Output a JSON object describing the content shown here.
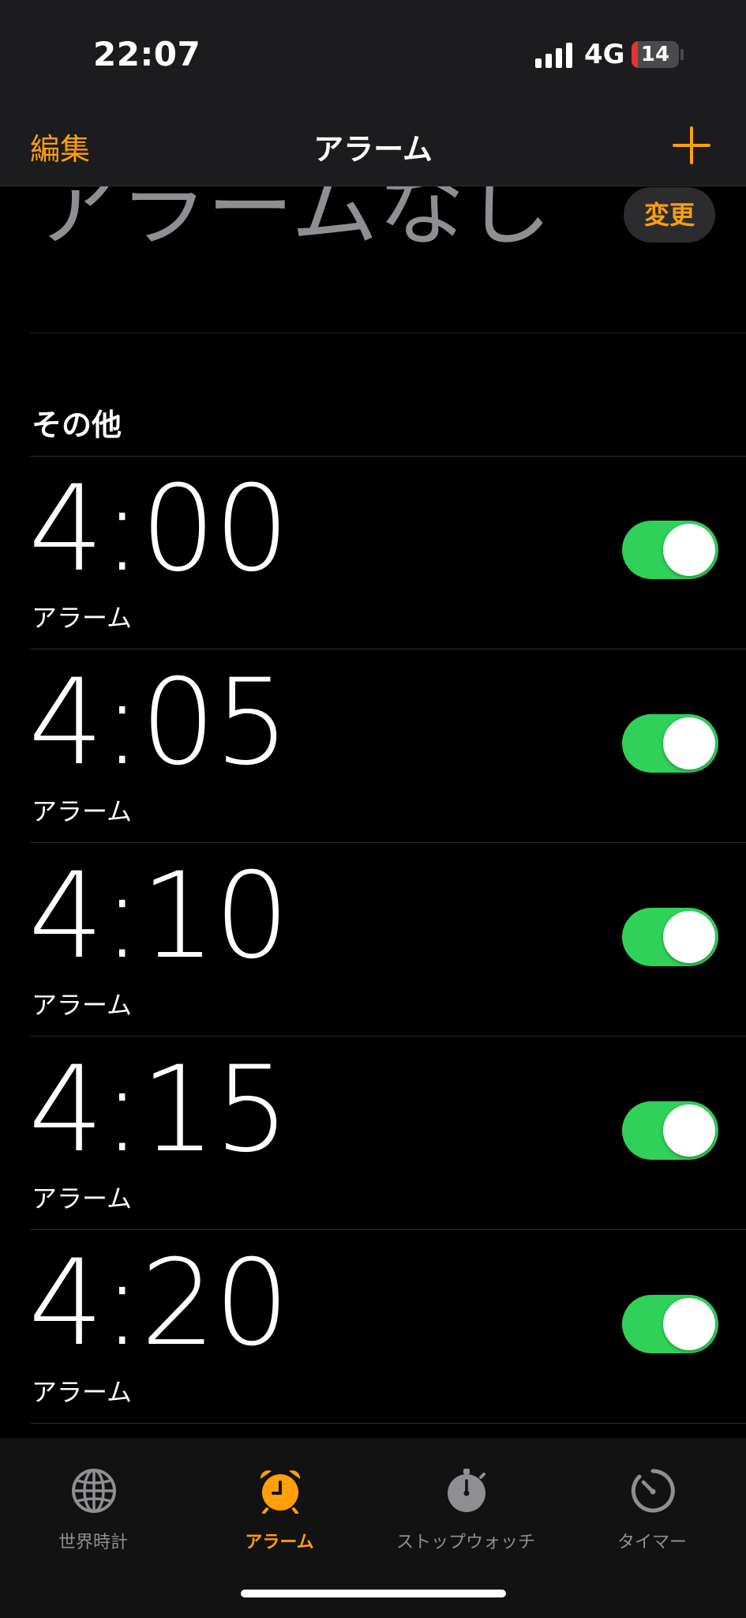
{
  "status_bar": {
    "time": "22:07",
    "network": "4G",
    "battery": "14",
    "battery_fraction": 0.14
  },
  "nav": {
    "edit_label": "編集",
    "title": "アラーム",
    "add_icon": "plus-icon"
  },
  "sleep": {
    "no_alarm_text": "アラームなし",
    "change_label": "変更"
  },
  "section": {
    "title": "その他"
  },
  "alarms": [
    {
      "time": "4:00",
      "label": "アラーム",
      "enabled": true
    },
    {
      "time": "4:05",
      "label": "アラーム",
      "enabled": true
    },
    {
      "time": "4:10",
      "label": "アラーム",
      "enabled": true
    },
    {
      "time": "4:15",
      "label": "アラーム",
      "enabled": true
    },
    {
      "time": "4:20",
      "label": "アラーム",
      "enabled": true
    }
  ],
  "tabs": [
    {
      "label": "世界時計",
      "icon": "globe-icon",
      "active": false
    },
    {
      "label": "アラーム",
      "icon": "alarm-clock-icon",
      "active": true
    },
    {
      "label": "ストップウォッチ",
      "icon": "stopwatch-icon",
      "active": false
    },
    {
      "label": "タイマー",
      "icon": "timer-icon",
      "active": false
    }
  ],
  "colors": {
    "accent": "#ff9f0a",
    "toggle_on": "#30d158",
    "inactive": "#8e8e93",
    "battery_low": "#e5342e"
  }
}
